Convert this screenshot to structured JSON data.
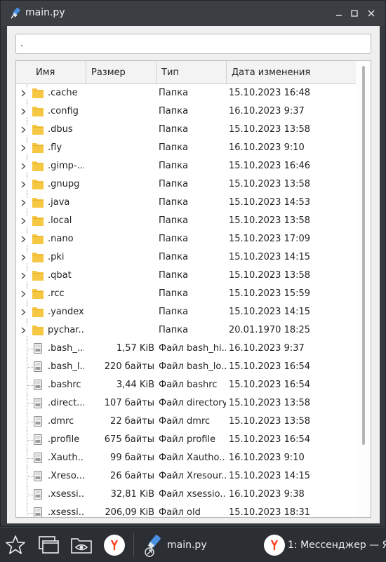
{
  "window": {
    "title": "main.py"
  },
  "path_input": {
    "value": "."
  },
  "columns": [
    "Имя",
    "Размер",
    "Тип",
    "Дата изменения"
  ],
  "rows": [
    {
      "name": ".cache",
      "size": "",
      "type": "Папка",
      "date": "15.10.2023 16:48",
      "kind": "folder"
    },
    {
      "name": ".config",
      "size": "",
      "type": "Папка",
      "date": "16.10.2023 9:37",
      "kind": "folder"
    },
    {
      "name": ".dbus",
      "size": "",
      "type": "Папка",
      "date": "15.10.2023 13:58",
      "kind": "folder"
    },
    {
      "name": ".fly",
      "size": "",
      "type": "Папка",
      "date": "16.10.2023 9:10",
      "kind": "folder"
    },
    {
      "name": ".gimp-...",
      "size": "",
      "type": "Папка",
      "date": "15.10.2023 16:46",
      "kind": "folder"
    },
    {
      "name": ".gnupg",
      "size": "",
      "type": "Папка",
      "date": "15.10.2023 13:58",
      "kind": "folder"
    },
    {
      "name": ".java",
      "size": "",
      "type": "Папка",
      "date": "15.10.2023 14:53",
      "kind": "folder"
    },
    {
      "name": ".local",
      "size": "",
      "type": "Папка",
      "date": "15.10.2023 13:58",
      "kind": "folder"
    },
    {
      "name": ".nano",
      "size": "",
      "type": "Папка",
      "date": "15.10.2023 17:09",
      "kind": "folder"
    },
    {
      "name": ".pki",
      "size": "",
      "type": "Папка",
      "date": "15.10.2023 14:15",
      "kind": "folder"
    },
    {
      "name": ".qbat",
      "size": "",
      "type": "Папка",
      "date": "15.10.2023 13:58",
      "kind": "folder"
    },
    {
      "name": ".rcc",
      "size": "",
      "type": "Папка",
      "date": "15.10.2023 15:59",
      "kind": "folder"
    },
    {
      "name": ".yandex",
      "size": "",
      "type": "Папка",
      "date": "15.10.2023 14:15",
      "kind": "folder"
    },
    {
      "name": "pychar...",
      "size": "",
      "type": "Папка",
      "date": "20.01.1970 18:25",
      "kind": "folder"
    },
    {
      "name": ".bash_...",
      "size": "1,57 KiB",
      "type": "Файл bash_hi...",
      "date": "16.10.2023 9:37",
      "kind": "file"
    },
    {
      "name": ".bash_l...",
      "size": "220 байты",
      "type": "Файл bash_lo...",
      "date": "15.10.2023 16:54",
      "kind": "file"
    },
    {
      "name": ".bashrc",
      "size": "3,44 KiB",
      "type": "Файл bashrc",
      "date": "15.10.2023 16:54",
      "kind": "file"
    },
    {
      "name": ".direct...",
      "size": "107 байты",
      "type": "Файл directory",
      "date": "15.10.2023 13:58",
      "kind": "file"
    },
    {
      "name": ".dmrc",
      "size": "22 байты",
      "type": "Файл dmrc",
      "date": "15.10.2023 13:58",
      "kind": "file"
    },
    {
      "name": ".profile",
      "size": "675 байты",
      "type": "Файл profile",
      "date": "15.10.2023 16:54",
      "kind": "file"
    },
    {
      "name": ".Xauth...",
      "size": "99 байты",
      "type": "Файл Xautho...",
      "date": "16.10.2023 9:10",
      "kind": "file"
    },
    {
      "name": ".Xreso...",
      "size": "26 байты",
      "type": "Файл Xresour...",
      "date": "15.10.2023 14:15",
      "kind": "file"
    },
    {
      "name": ".xsessi...",
      "size": "32,81 KiB",
      "type": "Файл xsessio...",
      "date": "16.10.2023 9:38",
      "kind": "file"
    },
    {
      "name": ".xsessi...",
      "size": "206,09 KiB",
      "type": "Файл old",
      "date": "15.10.2023 18:31",
      "kind": "file"
    }
  ],
  "taskbar": {
    "task_main": "main.py",
    "task_messenger": "1: Мессенджер — Я..."
  },
  "icons": {
    "folder": "folder-icon",
    "file": "file-icon",
    "expander": "chevron-right-icon"
  },
  "colors": {
    "folder": "#f6c743",
    "title_bar": "#3b3f44",
    "taskbar": "#2b2f33",
    "yandex_red": "#fc3f1d"
  }
}
